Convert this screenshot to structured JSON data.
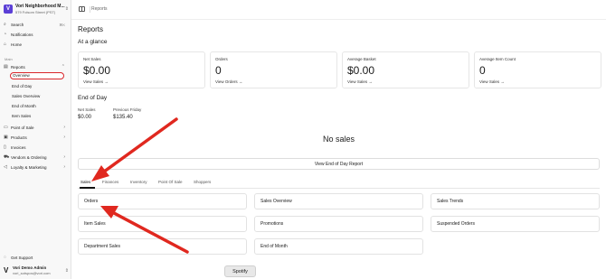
{
  "store": {
    "name": "Vori Neighborhood M...",
    "address": "579 Folsom Street (PST)",
    "logo_letter": "V",
    "icon": "chevron-up-down-icon"
  },
  "sidebar": {
    "search_label": "Search",
    "search_shortcut": "⌘K",
    "notifications_label": "Notifications",
    "home_label": "Home",
    "section_label": "Main",
    "reports_label": "Reports",
    "reports_sub": [
      "Overview",
      "End of Day",
      "Sales Overview",
      "End of Month",
      "Item Sales"
    ],
    "items": [
      "Point of Sale",
      "Products",
      "Invoices",
      "Vendors & Ordering",
      "Loyalty & Marketing"
    ],
    "support_label": "Get Support"
  },
  "user": {
    "name": "Vori Demo Admin",
    "email": "vori_sotspos@vori.com",
    "logo": "V"
  },
  "topbar": {
    "breadcrumb": "Reports"
  },
  "page": {
    "title": "Reports",
    "glance_title": "At a glance",
    "kpis": [
      {
        "label": "Net Sales",
        "value": "$0.00",
        "link": "View Sales →"
      },
      {
        "label": "Orders",
        "value": "0",
        "link": "View Orders →"
      },
      {
        "label": "Average Basket",
        "value": "$0.00",
        "link": "View Sales →"
      },
      {
        "label": "Average Item Count",
        "value": "0",
        "link": "View Sales →"
      }
    ],
    "eod_title": "End of Day",
    "eod_net_label": "Net Sales",
    "eod_net_value": "$0.00",
    "eod_prev_label": "Previous Friday",
    "eod_prev_value": "$135.40",
    "no_sales": "No sales",
    "eod_button": "View End of Day Report",
    "tabs": [
      "Sales",
      "Finances",
      "Inventory",
      "Point Of Sale",
      "Shoppers"
    ],
    "cards": [
      "Orders",
      "Sales Overview",
      "Sales Trends",
      "Item Sales",
      "Promotions",
      "Suspended Orders",
      "Department Sales",
      "End of Month"
    ]
  },
  "spotify_button": "Spotify",
  "colors": {
    "accent": "#5b3fd6",
    "annotation": "#e0281f",
    "highlight_ring": "#d9262b"
  }
}
